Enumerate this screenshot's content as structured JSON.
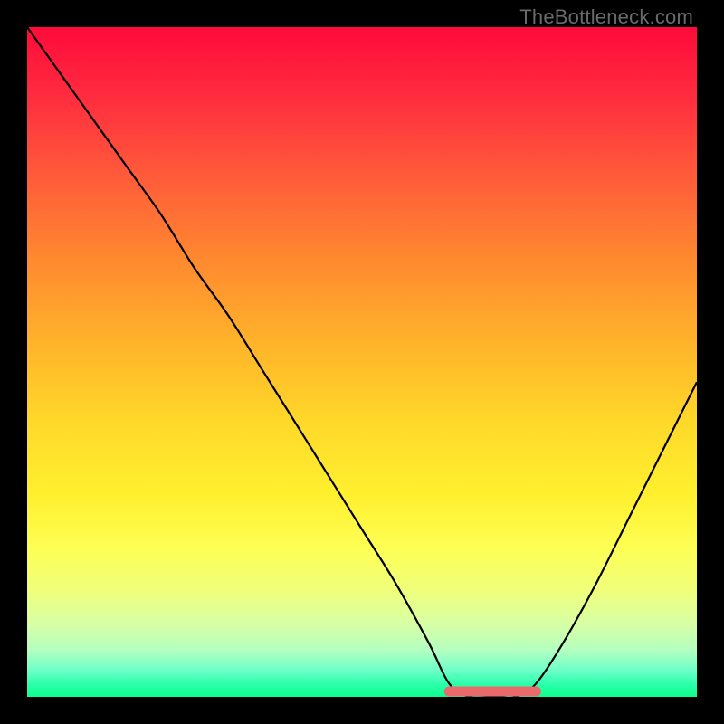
{
  "watermark": "TheBottleneck.com",
  "chart_data": {
    "type": "line",
    "title": "",
    "xlabel": "",
    "ylabel": "",
    "xlim": [
      0,
      100
    ],
    "ylim": [
      0,
      100
    ],
    "x": [
      0,
      5,
      10,
      15,
      20,
      25,
      30,
      35,
      40,
      45,
      50,
      55,
      60,
      63,
      66,
      70,
      73,
      76,
      80,
      85,
      90,
      95,
      100
    ],
    "values": [
      100,
      93,
      86,
      79,
      72,
      64,
      57,
      49,
      41,
      33,
      25,
      17,
      8,
      2,
      0,
      0,
      0,
      2,
      8,
      17,
      27,
      37,
      47
    ],
    "flat_segment": {
      "x_start": 63,
      "x_end": 76,
      "style": "thick-red-rounded"
    },
    "background_gradient": {
      "top": "#ff0a3a",
      "bottom": "#0aff8a",
      "stops": [
        "red",
        "orange",
        "yellow",
        "green"
      ]
    },
    "colors": {
      "line": "#000000",
      "flat_segment": "#e86a6a",
      "frame": "#000000"
    }
  }
}
